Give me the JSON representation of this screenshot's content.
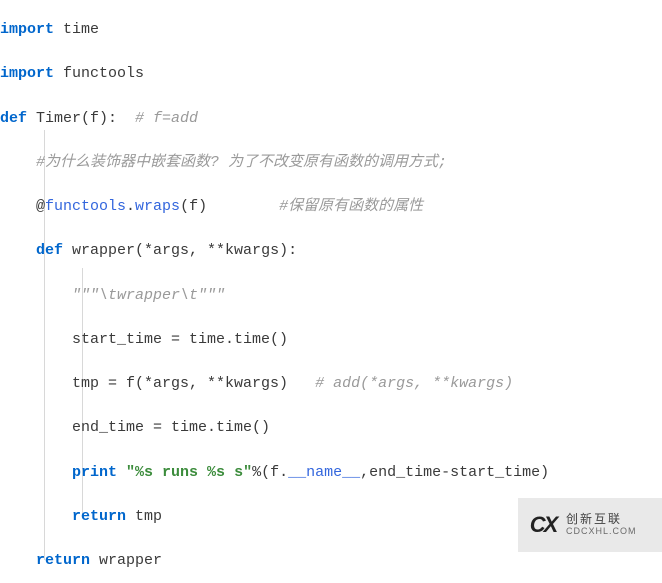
{
  "code": {
    "l1_kw": "import",
    "l1_mod": " time",
    "l2_kw": "import",
    "l2_mod": " functools",
    "l3_kw": "def",
    "l3_name": " Timer(f): ",
    "l3_cm": " # f=add",
    "l4_cm": "#为什么装饰器中嵌套函数? 为了不改变原有函数的调用方式;",
    "l5_at": "    @",
    "l5_fn": "functools",
    "l5_dot": ".",
    "l5_wr": "wraps",
    "l5_arg": "(f)",
    "l5_sp": "        ",
    "l5_cm": "#保留原有函数的属性",
    "l6_kw": "def",
    "l6_sig": " wrapper(*args, **kwargs):",
    "l7_doc": "\"\"\"\\twrapper\\t\"\"\"",
    "l8": "start_time = time.time()",
    "l9a": "tmp = f(*args, **kwargs)",
    "l9sp": "   ",
    "l9_cm": "# add(*args, **kwargs)",
    "l10": "end_time = time.time()",
    "l11_kw": "print",
    "l11_sp": " ",
    "l11_str": "\"%s runs %s s\"",
    "l11_mid": "%(f.",
    "l11_name": "__name__",
    "l11_end": ",end_time-start_time)",
    "l12_kw": "return",
    "l12_v": " tmp",
    "l13_kw": "return",
    "l13_v": " wrapper"
  },
  "watermark": {
    "logo": "CX",
    "top": "创新互联",
    "bottom": "CDCXHL.COM"
  }
}
